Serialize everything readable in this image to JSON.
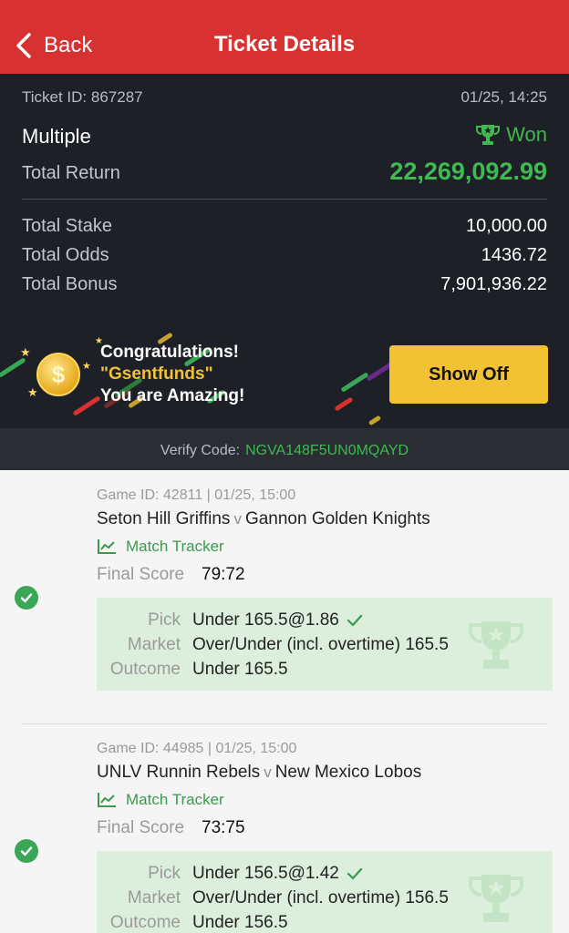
{
  "header": {
    "back_label": "Back",
    "title": "Ticket Details"
  },
  "ticket": {
    "id_text": "Ticket ID: 867287",
    "time": "01/25, 14:25",
    "bet_type": "Multiple",
    "status": "Won",
    "total_return_label": "Total Return",
    "total_return": "22,269,092.99",
    "rows": [
      {
        "label": "Total Stake",
        "value": "10,000.00"
      },
      {
        "label": "Total Odds",
        "value": "1436.72"
      },
      {
        "label": "Total Bonus",
        "value": "7,901,936.22"
      }
    ]
  },
  "banner": {
    "line1": "Congratulations!",
    "line2": "\"Gsentfunds\"",
    "line3": "You are Amazing!",
    "button": "Show Off"
  },
  "verify": {
    "label": "Verify Code:",
    "code": "NGVA148F5UN0MQAYD"
  },
  "games": [
    {
      "game_id": "Game ID: 42811 | 01/25, 15:00",
      "home": "Seton Hill Griffins",
      "vs": "v",
      "away": "Gannon Golden Knights",
      "tracker": "Match Tracker",
      "score_label": "Final Score",
      "score": "79:72",
      "pick_label": "Pick",
      "pick": "Under 165.5@1.86",
      "market_label": "Market",
      "market": "Over/Under (incl. overtime) 165.5",
      "outcome_label": "Outcome",
      "outcome": "Under 165.5"
    },
    {
      "game_id": "Game ID: 44985 | 01/25, 15:00",
      "home": "UNLV Runnin Rebels",
      "vs": "v",
      "away": "New Mexico Lobos",
      "tracker": "Match Tracker",
      "score_label": "Final Score",
      "score": "73:75",
      "pick_label": "Pick",
      "pick": "Under 156.5@1.42",
      "market_label": "Market",
      "market": "Over/Under (incl. overtime) 156.5",
      "outcome_label": "Outcome",
      "outcome": "Under 156.5"
    }
  ],
  "colors": {
    "header_bg": "#d83131",
    "dark_bg": "#1d2026",
    "won_green": "#3fb950",
    "accent_yellow": "#f2c232",
    "pick_box_bg": "#dcefdc"
  },
  "icons": [
    "chevron-left-icon",
    "trophy-icon",
    "coin-icon",
    "chart-line-icon",
    "check-circle-icon",
    "check-icon"
  ]
}
